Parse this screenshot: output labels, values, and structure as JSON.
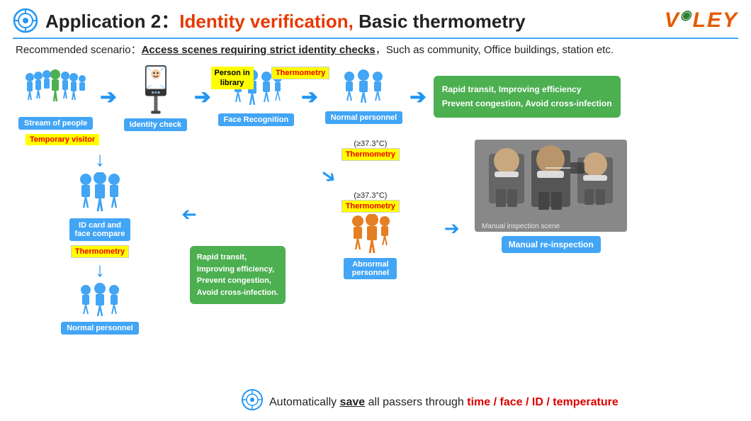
{
  "header": {
    "app_label": "Application 2：",
    "identity_label": "Identity verification,",
    "basic_label": " Basic thermometry",
    "logo": "VGLEY",
    "logo_v": "V",
    "logo_middle": "◉",
    "logo_rest": "LEY"
  },
  "scenario": {
    "prefix": "Recommended scenario：",
    "bold_text": "Access scenes requiring strict identity checks",
    "suffix": "，Such as community, Office buildings, station etc."
  },
  "top_flow": {
    "stream_label": "Stream of people",
    "identity_label": "Identity check",
    "person_in_library": "Person in\nlibrary",
    "thermometry1": "Thermometry",
    "face_label": "Face Recognition",
    "normal_label": "Normal personnel",
    "rapid_transit": "Rapid transit, Improving efficiency\nPrevent congestion, Avoid cross-infection"
  },
  "bottom_flow": {
    "temp_visitor": "Temporary visitor",
    "geq_temp1": "(≥37.3°C)",
    "thermometry2": "Thermometry",
    "id_card_label": "ID card and\nface compare",
    "geq_temp2": "(≥37.3°C)",
    "thermometry3": "Thermometry",
    "abnormal_label": "Abnormal\npersonnel",
    "manual_label": "Manual re-inspection",
    "thermometry4": "Thermometry",
    "rapid_transit2": "Rapid transit,\nImproving efficiency,\nPrevent congestion,\nAvoid cross-infection.",
    "normal_label2": "Normal personnel"
  },
  "summary": {
    "icon": "⊕",
    "prefix": "Automatically ",
    "save_word": "save",
    "middle": " all passers through ",
    "time_word": "time",
    "slash1": " / ",
    "face_word": "face",
    "slash2": " / ",
    "id_word": "ID",
    "slash3": " / ",
    "temp_word": "temperature"
  },
  "colors": {
    "blue": "#2196F3",
    "orange": "#e55a00",
    "green": "#4caf50",
    "yellow": "#ffff00",
    "red": "#dd0000",
    "light_blue_label": "#42a5f5"
  }
}
